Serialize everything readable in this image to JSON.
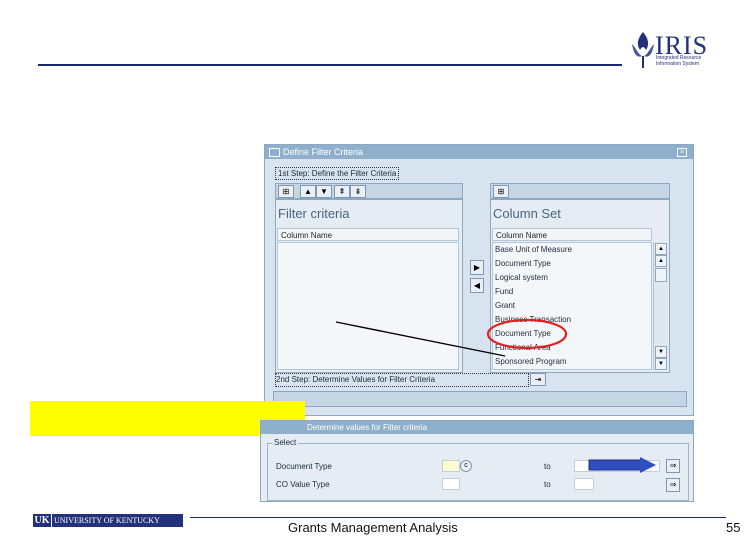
{
  "logo": {
    "brand": "IRIS",
    "subtitle_lines": [
      "Integrated Resource",
      "Information System"
    ]
  },
  "window1": {
    "title": "Define Filter Criteria",
    "step1": "1st Step: Define the Filter Criteria",
    "left_panel": {
      "title": "Filter criteria",
      "column_header": "Column Name"
    },
    "right_panel": {
      "title": "Column Set",
      "column_header": "Column Name",
      "rows": [
        "Base Unit of Measure",
        "Document Type",
        "Logical system",
        "Fund",
        "Grant",
        "Business Transaction",
        "Document Type",
        "Functional Area",
        "Sponsored Program"
      ],
      "highlighted_index": 6
    },
    "step2": "2nd Step: Determine Values for Filter Criteria"
  },
  "window2": {
    "title": "Determine values for Filter criteria",
    "group_label": "Select",
    "rows": [
      {
        "label": "Document Type",
        "to": "to"
      },
      {
        "label": "CO Value Type",
        "to": "to"
      }
    ]
  },
  "colors": {
    "highlight": "#ffff00",
    "circle": "#e02020",
    "arrow": "#2f4fc0",
    "brand": "#23307a"
  },
  "footer": {
    "uk_initials": "UK",
    "university": "UNIVERSITY OF KENTUCKY",
    "title": "Grants Management Analysis",
    "page": "55"
  }
}
